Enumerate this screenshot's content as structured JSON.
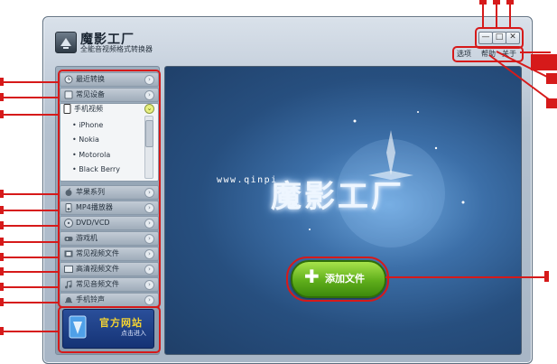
{
  "app": {
    "title": "魔影工厂",
    "subtitle": "全能音视频格式转换器"
  },
  "window_controls": {
    "minimize": "—",
    "maximize": "□",
    "close": "✕"
  },
  "menu": {
    "options": "选项",
    "help": "帮助",
    "about": "关于"
  },
  "sidebar": {
    "items": [
      {
        "label": "最近转换",
        "icon": "clock-icon"
      },
      {
        "label": "常见设备",
        "icon": "device-icon"
      },
      {
        "label": "手机视频",
        "icon": "phone-icon"
      },
      {
        "label": "苹果系列",
        "icon": "apple-icon"
      },
      {
        "label": "MP4播放器",
        "icon": "mp4-icon"
      },
      {
        "label": "DVD/VCD",
        "icon": "disc-icon"
      },
      {
        "label": "游戏机",
        "icon": "gamepad-icon"
      },
      {
        "label": "常见视频文件",
        "icon": "film-icon"
      },
      {
        "label": "高清视频文件",
        "icon": "hd-icon"
      },
      {
        "label": "常见音频文件",
        "icon": "music-icon"
      },
      {
        "label": "手机铃声",
        "icon": "ringtone-icon"
      }
    ],
    "phone_sub_items": [
      "iPhone",
      "Nokia",
      "Motorola",
      "Black Berry"
    ],
    "promo": {
      "title": "官方网站",
      "subtitle": "点击进入"
    }
  },
  "main": {
    "watermark": "www.qinpi",
    "logo_text": "魔影工厂",
    "add_button": "添加文件"
  },
  "colors": {
    "annotation": "#d61a1a",
    "add_button": "#6fbf22",
    "content_bg": "#2e5e94"
  }
}
